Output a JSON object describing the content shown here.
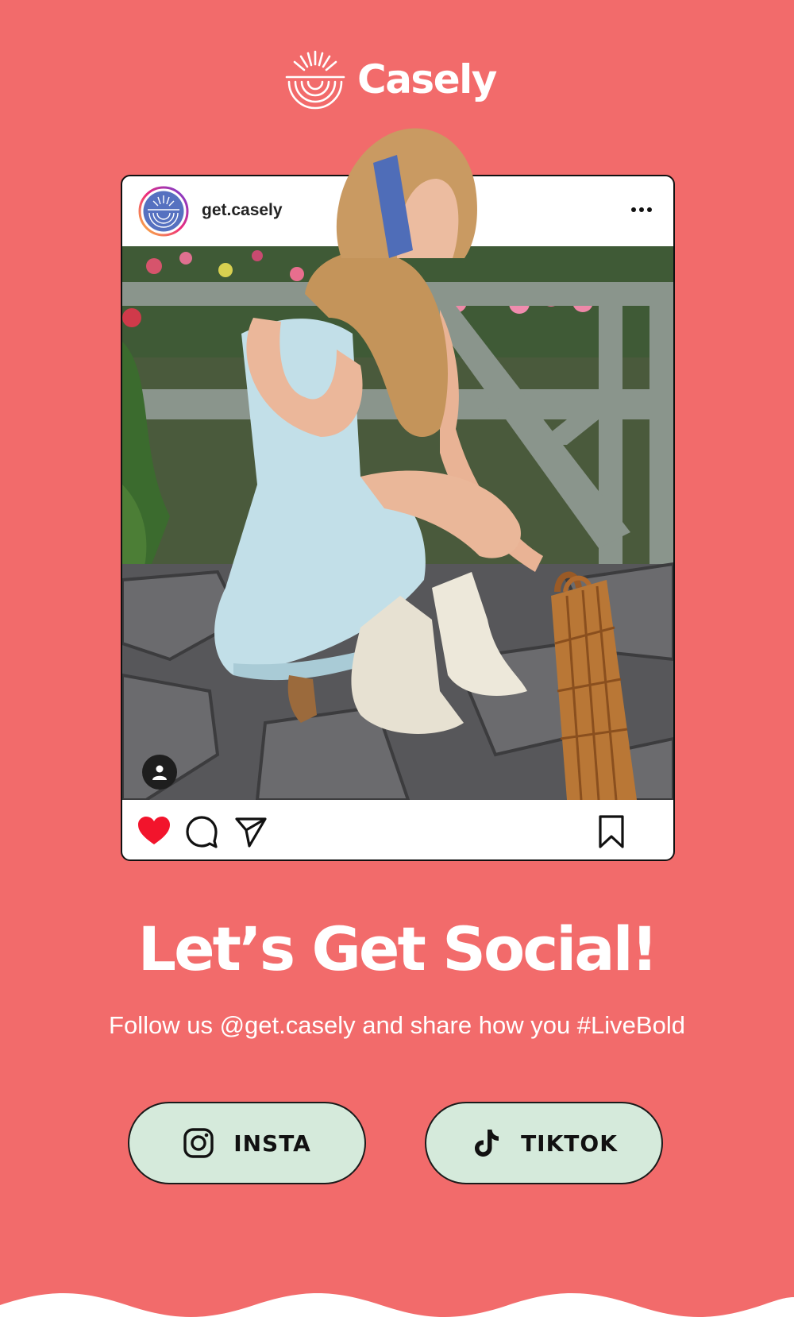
{
  "brand": {
    "name": "Casely",
    "logo_icon": "sunrise-arcs-icon"
  },
  "post": {
    "handle": "get.casely",
    "more_icon": "more-dots-icon",
    "photo_alt": "",
    "user_tag_icon": "person-icon",
    "actions": {
      "like_icon": "heart-icon",
      "comment_icon": "comment-bubble-icon",
      "share_icon": "paper-plane-icon",
      "save_icon": "bookmark-icon"
    },
    "liked": true
  },
  "headline": "Let’s Get Social!",
  "subline": "Follow us @get.casely and share how you #LiveBold",
  "buttons": [
    {
      "label": "INSTA",
      "icon": "instagram-icon"
    },
    {
      "label": "TIKTOK",
      "icon": "tiktok-icon"
    }
  ],
  "colors": {
    "background": "#f26b6b",
    "button_fill": "#d5eadb",
    "heart": "#f2142c",
    "text_on_bg": "#ffffff"
  }
}
